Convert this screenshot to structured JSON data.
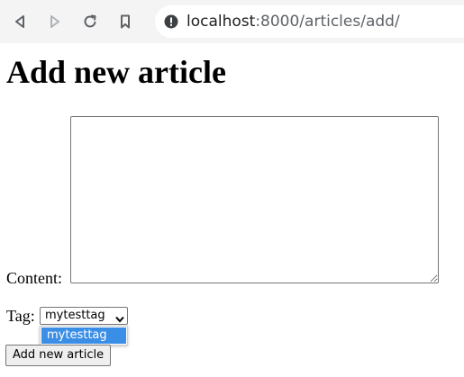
{
  "browser": {
    "url_host": "localhost",
    "url_rest": ":8000/articles/add/",
    "icons": {
      "back": "back-arrow-icon",
      "forward": "forward-arrow-icon",
      "reload": "reload-icon",
      "bookmark": "bookmark-icon",
      "site_info": "info-icon"
    }
  },
  "page": {
    "title": "Add new article",
    "content_label": "Content:",
    "content_value": "",
    "tag_label": "Tag:",
    "tag_selected": "mytesttag",
    "tag_options": [
      "mytesttag"
    ],
    "submit_label": "Add new article"
  },
  "colors": {
    "selected_option": "#3b8ee6",
    "toolbar_bg": "#f4f4f5"
  }
}
